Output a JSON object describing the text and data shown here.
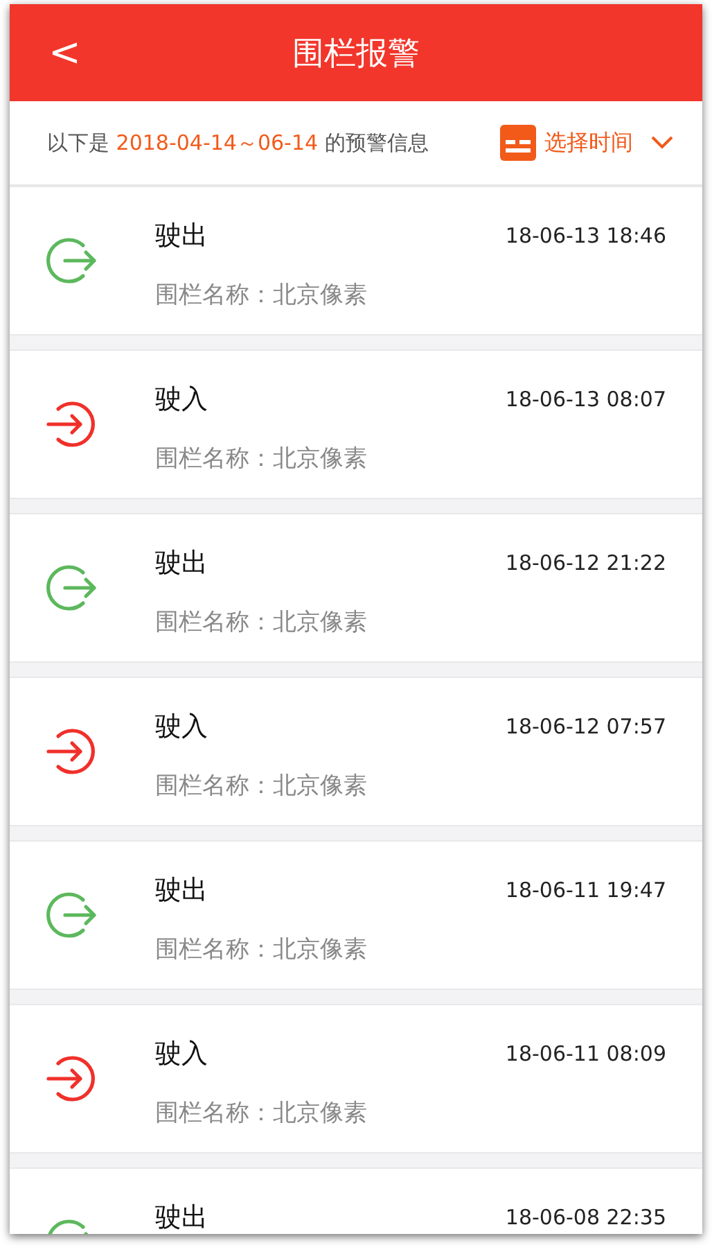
{
  "header": {
    "back": "<",
    "title": "围栏报警"
  },
  "range_bar": {
    "prefix": "以下是 ",
    "range": "2018-04-14～06-14",
    "suffix": " 的预警信息",
    "picker": "选择时间"
  },
  "alerts": [
    {
      "kind": "exit",
      "title": "驶出",
      "time": "18-06-13 18:46",
      "fence": "围栏名称：北京像素"
    },
    {
      "kind": "enter",
      "title": "驶入",
      "time": "18-06-13 08:07",
      "fence": "围栏名称：北京像素"
    },
    {
      "kind": "exit",
      "title": "驶出",
      "time": "18-06-12 21:22",
      "fence": "围栏名称：北京像素"
    },
    {
      "kind": "enter",
      "title": "驶入",
      "time": "18-06-12 07:57",
      "fence": "围栏名称：北京像素"
    },
    {
      "kind": "exit",
      "title": "驶出",
      "time": "18-06-11 19:47",
      "fence": "围栏名称：北京像素"
    },
    {
      "kind": "enter",
      "title": "驶入",
      "time": "18-06-11 08:09",
      "fence": "围栏名称：北京像素"
    },
    {
      "kind": "exit",
      "title": "驶出",
      "time": "18-06-08 22:35"
    }
  ]
}
